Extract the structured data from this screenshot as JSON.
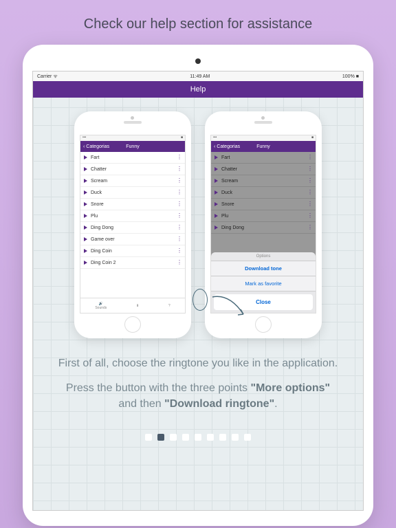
{
  "header": "Check our help section for assistance",
  "tablet": {
    "status": {
      "carrier": "Carrier",
      "time": "11:49 AM",
      "battery": "100%"
    },
    "nav": "Help"
  },
  "phone": {
    "nav": {
      "back": "Categorias",
      "title": "Funny"
    },
    "rowsA": [
      "Fart",
      "Chatter",
      "Scream",
      "Duck",
      "Snore",
      "Plu",
      "Ding Dong",
      "Game over",
      "Ding Coin",
      "Ding Coin 2"
    ],
    "rowsB": [
      "Fart",
      "Chatter",
      "Scream",
      "Duck",
      "Snore",
      "Plu",
      "Ding Dong"
    ],
    "tabs": [
      "Sounds",
      "",
      "?"
    ],
    "sheet": {
      "h": "Options",
      "a": "Download tone",
      "b": "Mark as favorite",
      "c": "Close"
    }
  },
  "desc": {
    "l1": "First of all, choose the ringtone you like in the application.",
    "l2a": "Press the button with the three points ",
    "l2b": "\"More options\"",
    "l2c": " and then ",
    "l2d": "\"Download ringtone\"",
    "l2e": "."
  },
  "dots": {
    "count": 9,
    "active": 1
  }
}
